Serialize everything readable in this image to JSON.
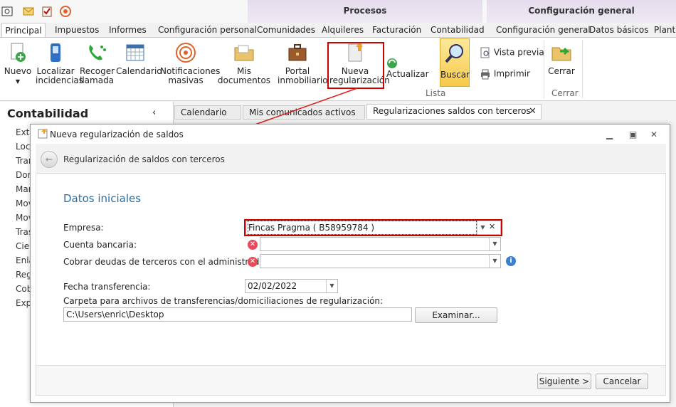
{
  "context_groups": {
    "procesos": "Procesos",
    "config": "Configuración general"
  },
  "tabs": [
    "Principal",
    "Impuestos",
    "Informes",
    "Configuración personal",
    "Comunidades",
    "Alquileres",
    "Facturación",
    "Contabilidad",
    "Configuración general",
    "Datos básicos",
    "Plantill"
  ],
  "ribbon": {
    "nuevo": "Nuevo",
    "localizar": "Localizar incidencias",
    "recoger": "Recoger llamada",
    "calendario": "Calendario",
    "notificaciones": "Notificaciones masivas",
    "mis_documentos": "Mis documentos",
    "portal": "Portal inmobiliario",
    "nueva_reg": "Nueva regularización",
    "actualizar": "Actualizar",
    "buscar": "Buscar",
    "vista_previa": "Vista previa",
    "imprimir": "Imprimir",
    "cerrar": "Cerrar",
    "group_lista": "Lista",
    "group_cerrar": "Cerrar"
  },
  "left_panel": {
    "title": "Contabilidad",
    "items": [
      "Extr",
      "Loca",
      "Tran",
      "Dom",
      "Man",
      "Movi",
      "Movi",
      "Tras",
      "Cier",
      "Enla",
      "Regi",
      "Cob",
      "Expo"
    ]
  },
  "doc_tabs": [
    "Calendario",
    "Mis comunicados activos",
    "Regularizaciones saldos con terceros"
  ],
  "dialog": {
    "title": "Nueva regularización de saldos",
    "header": "Regularización de saldos con terceros",
    "section": "Datos iniciales",
    "empresa_label": "Empresa:",
    "empresa_value": "Fincas Pragma ( B58959784 )",
    "cuenta_label": "Cuenta bancaria:",
    "cuenta_value": "",
    "cobrar_label": "Cobrar deudas de terceros con el administrador por:",
    "cobrar_value": "",
    "fecha_label": "Fecha transferencia:",
    "fecha_value": "02/02/2022",
    "carpeta_label": "Carpeta para archivos de transferencias/domiciliaciones de regularización:",
    "carpeta_value": "C:\\Users\\enric\\Desktop",
    "examinar": "Examinar...",
    "siguiente": "Siguiente >",
    "cancelar": "Cancelar"
  }
}
